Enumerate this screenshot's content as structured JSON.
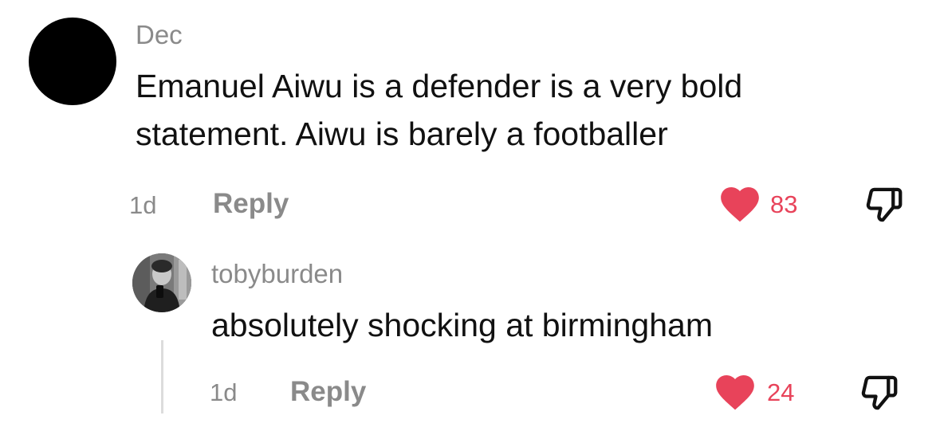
{
  "comment": {
    "username": "Dec",
    "text_line1": "Emanuel Aiwu is a defender is a very bold",
    "text_line2": "statement. Aiwu is barely a footballer",
    "time": "1d",
    "reply_label": "Reply",
    "likes": "83",
    "like_icon": "heart-filled-icon",
    "dislike_icon": "thumbs-down-icon"
  },
  "reply": {
    "username": "tobyburden",
    "text": "absolutely shocking at birmingham",
    "time": "1d",
    "reply_label": "Reply",
    "likes": "24",
    "like_icon": "heart-filled-icon",
    "dislike_icon": "thumbs-down-icon"
  },
  "colors": {
    "like_accent": "#e8435a",
    "muted_text": "#8a8a8a",
    "primary_text": "#111111"
  }
}
